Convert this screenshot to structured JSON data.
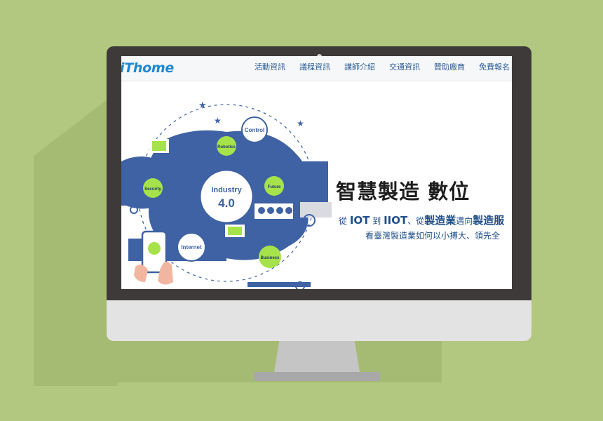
{
  "brand": {
    "logo_text": "iThome"
  },
  "nav": {
    "items": [
      {
        "label": "活動資訊"
      },
      {
        "label": "議程資訊"
      },
      {
        "label": "講師介紹"
      },
      {
        "label": "交通資訊"
      },
      {
        "label": "贊助廠商"
      },
      {
        "label": "免費報名",
        "caret": "▾"
      }
    ]
  },
  "hero": {
    "title": "智慧製造 數位",
    "subtitle": {
      "part1": "從",
      "part2": "IOT",
      "part3": "到",
      "part4": "IIOT",
      "part5": "、從",
      "part6": "製造業",
      "part7": "邁向",
      "part8": "製造服"
    },
    "tagline": "看臺灣製造業如何以小搏大、領先全",
    "illustration": {
      "center_label_line1": "Industry",
      "center_label_line2": "4.0",
      "bubbles": [
        "Control",
        "Robotics",
        "Security",
        "Future",
        "Internet",
        "Business"
      ]
    }
  },
  "colors": {
    "background": "#b2c880",
    "bezel": "#3d3a39",
    "chin": "#e3e3e4",
    "logo": "#1f88cf",
    "nav_link": "#2d5f94",
    "illustration_blue": "#3e62a3",
    "illustration_green": "#a6e34a"
  }
}
